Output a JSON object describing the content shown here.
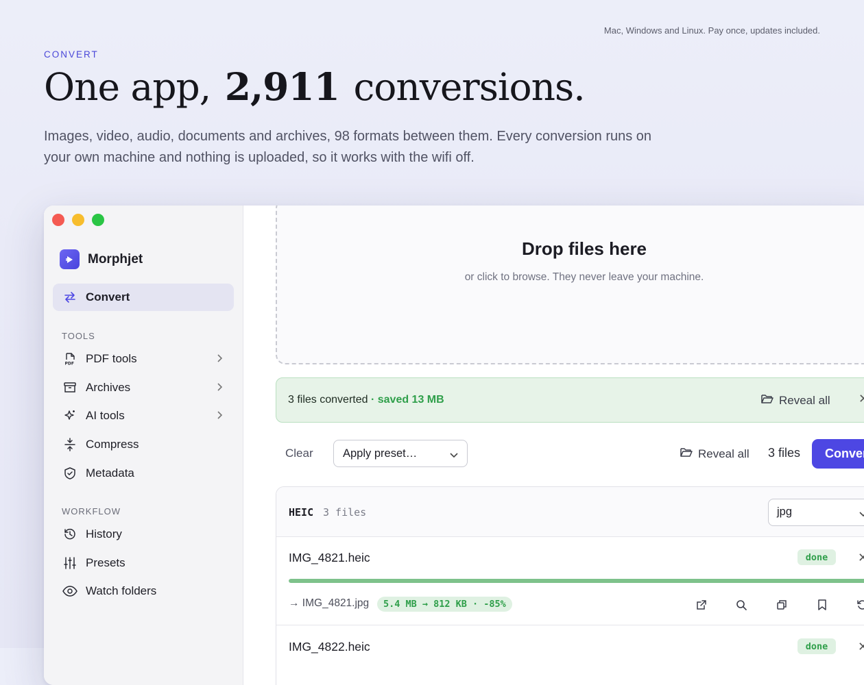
{
  "hero": {
    "top_note": "Mac, Windows and Linux. Pay once, updates included.",
    "eyebrow": "CONVERT",
    "headline_pre": "One app,",
    "headline_num": "2,911",
    "headline_post": "conversions.",
    "lead": "Images, video, audio, documents and archives, 98 formats between them. Every conversion runs on your own machine and nothing is uploaded, so it works with the wifi off."
  },
  "app": {
    "brand": "Morphjet",
    "sidebar": {
      "active": {
        "label": "Convert",
        "icon": "convert-arrows-icon"
      },
      "tools_header": "TOOLS",
      "tools": [
        {
          "label": "PDF tools",
          "icon": "pdf-icon",
          "has_chevron": true
        },
        {
          "label": "Archives",
          "icon": "archive-box-icon",
          "has_chevron": true
        },
        {
          "label": "AI tools",
          "icon": "sparkle-icon",
          "has_chevron": true
        },
        {
          "label": "Compress",
          "icon": "compress-icon",
          "has_chevron": false
        },
        {
          "label": "Metadata",
          "icon": "shield-check-icon",
          "has_chevron": false
        }
      ],
      "workflow_header": "WORKFLOW",
      "workflow": [
        {
          "label": "History",
          "icon": "history-icon"
        },
        {
          "label": "Presets",
          "icon": "sliders-icon"
        },
        {
          "label": "Watch folders",
          "icon": "eye-icon"
        }
      ]
    },
    "dropzone": {
      "title": "Drop files here",
      "subtitle": "or click to browse. They never leave your machine."
    },
    "banner": {
      "text": "3 files converted",
      "saved": "· saved 13 MB",
      "reveal": "Reveal all"
    },
    "toolbar": {
      "clear": "Clear",
      "preset_placeholder": "Apply preset…",
      "reveal": "Reveal all",
      "count": "3 files",
      "convert": "Convert"
    },
    "group": {
      "format": "HEIC",
      "count": "3 files",
      "target": "jpg",
      "files": [
        {
          "name": "IMG_4821.heic",
          "status": "done",
          "progress": 1.0,
          "output": "→ IMG_4821.jpg",
          "stats": "5.4 MB → 812 KB · -85%"
        },
        {
          "name": "IMG_4822.heic",
          "status": "done"
        }
      ]
    },
    "colors": {
      "accent": "#4d47e3",
      "success": "#2f9f4a",
      "success_bg": "#dff1e2"
    }
  }
}
